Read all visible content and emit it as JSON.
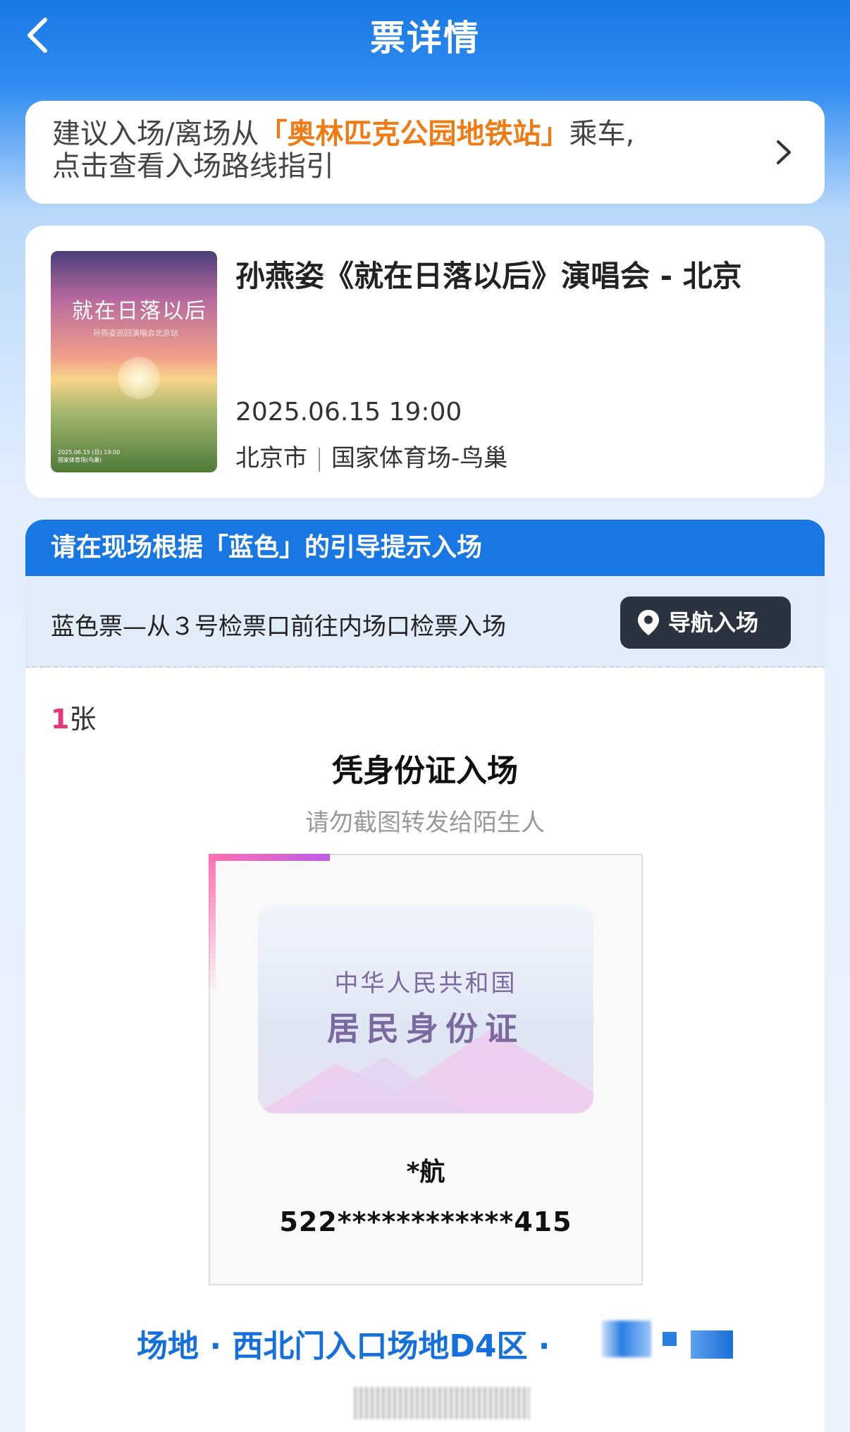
{
  "header": {
    "title": "票详情"
  },
  "tip": {
    "prefix": "建议入场/离场从",
    "station": "「奥林匹克公园地铁站」",
    "suffix": "乘车,",
    "line2": "点击查看入场路线指引"
  },
  "event": {
    "name": "孙燕姿《就在日落以后》演唱会 - 北京",
    "datetime": "2025.06.15 19:00",
    "city": "北京市",
    "venue": "国家体育场-鸟巢",
    "poster": {
      "title": "就在日落以后",
      "subtitle": "孙燕姿巡回演唱会北京站",
      "info": "2025.06.15 (日) 19:00\n国家体育场(鸟巢)"
    }
  },
  "guide": {
    "header": "请在现场根据「蓝色」的引导提示入场",
    "instruction": "蓝色票—从３号检票口前往内场口检票入场",
    "nav_label": "导航入场"
  },
  "ticket": {
    "count": "1",
    "count_unit": "张",
    "entry_method": "凭身份证入场",
    "warning": "请勿截图转发给陌生人",
    "id_country": "中华人民共和国",
    "id_type": "居民身份证",
    "holder_name": "*航",
    "id_number": "522************415",
    "seat": "场地 · 西北门入口场地D4区 ·"
  },
  "colors": {
    "primary_blue": "#1877e2",
    "highlight_orange": "#f07a14",
    "count_pink": "#e8357c",
    "nav_button": "#2b3240"
  }
}
